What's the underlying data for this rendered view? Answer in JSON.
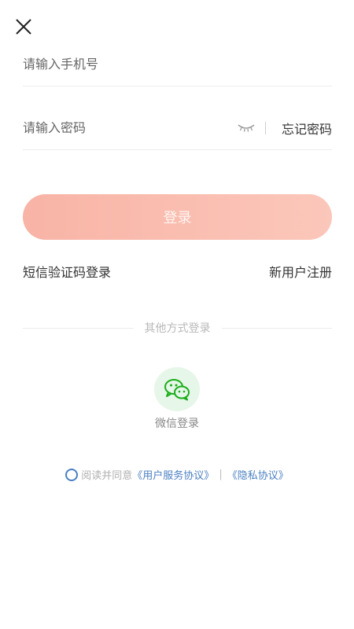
{
  "close": {
    "icon": "close-icon"
  },
  "phone": {
    "placeholder": "请输入手机号"
  },
  "password": {
    "placeholder": "请输入密码",
    "toggle_icon": "eye-closed-icon",
    "forgot_label": "忘记密码"
  },
  "login": {
    "label": "登录",
    "gradient_start": "#f8b4a6",
    "gradient_end": "#fbc7ba"
  },
  "links": {
    "sms_login": "短信验证码登录",
    "register": "新用户注册"
  },
  "other": {
    "title": "其他方式登录",
    "wechat_label": "微信登录",
    "wechat_icon": "wechat-icon",
    "wechat_color": "#1aad19"
  },
  "agreement": {
    "prefix": "阅读并同意",
    "terms": "《用户服务协议》",
    "separator": "|",
    "privacy": "《隐私协议》",
    "accent": "#4a7fc1"
  }
}
